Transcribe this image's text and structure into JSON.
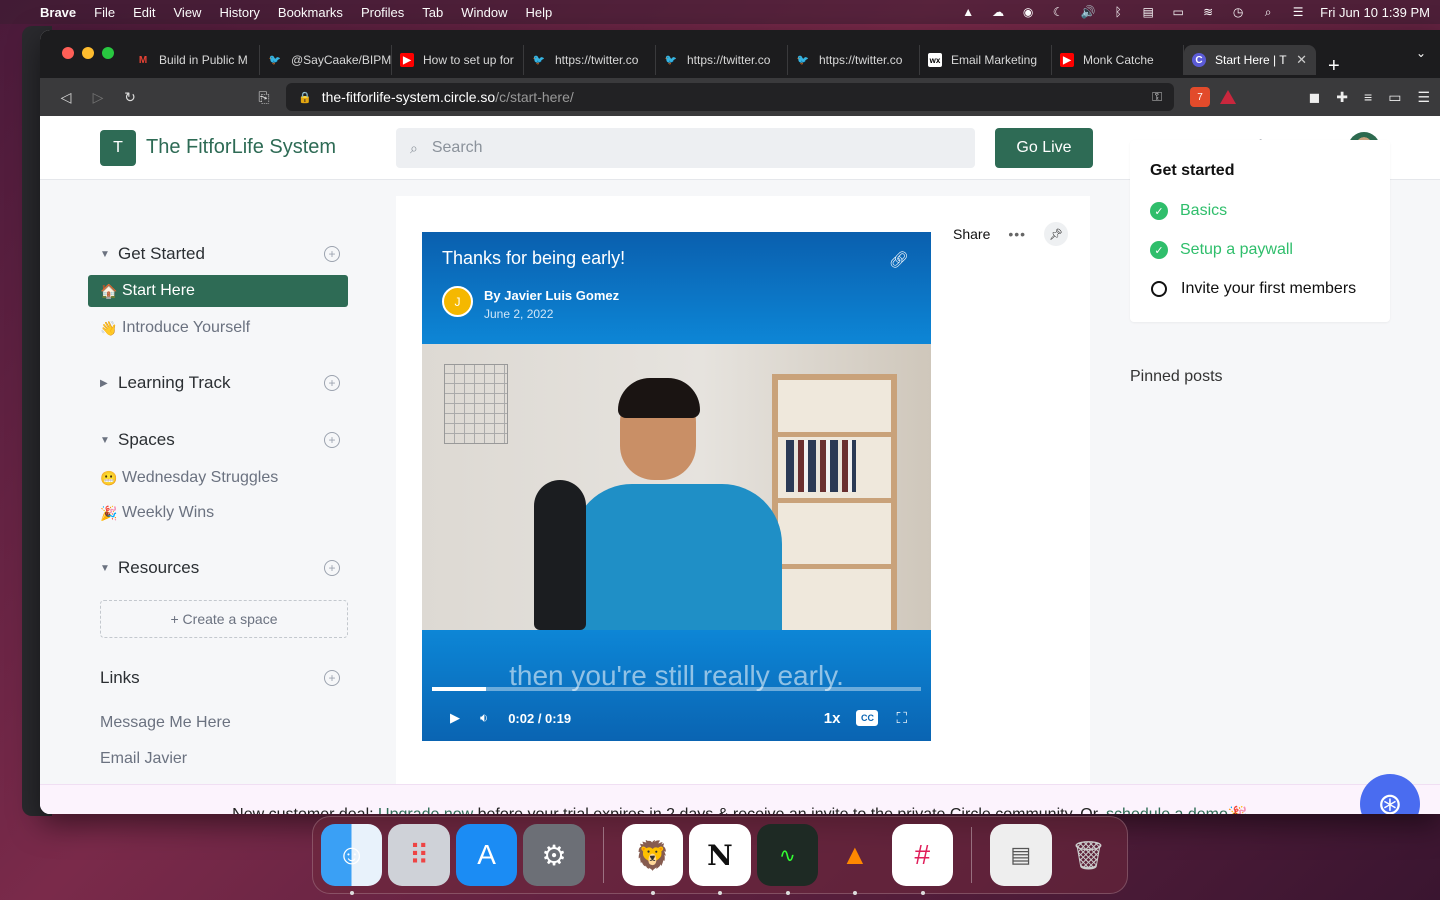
{
  "menubar": {
    "apple": "",
    "app": "Brave",
    "items": [
      "File",
      "Edit",
      "View",
      "History",
      "Bookmarks",
      "Profiles",
      "Tab",
      "Window",
      "Help"
    ],
    "datetime": "Fri Jun 10  1:39 PM"
  },
  "browser": {
    "tabs": [
      {
        "label": "Build in Public M",
        "favicon": "M",
        "color": "#ea4335"
      },
      {
        "label": "@SayCaake/BIPM",
        "favicon": "t",
        "color": "#1d9bf0"
      },
      {
        "label": "How to set up for",
        "favicon": "▶",
        "color": "#ff0000"
      },
      {
        "label": "https://twitter.co",
        "favicon": "t",
        "color": "#1d9bf0"
      },
      {
        "label": "https://twitter.co",
        "favicon": "t",
        "color": "#1d9bf0"
      },
      {
        "label": "https://twitter.co",
        "favicon": "t",
        "color": "#1d9bf0"
      },
      {
        "label": "Email Marketing",
        "favicon": "wx",
        "color": "#ffffff"
      },
      {
        "label": "Monk Catche",
        "favicon": "▶",
        "color": "#ff0000"
      },
      {
        "label": "Start Here | T",
        "favicon": "C",
        "color": "#5b5bd6"
      }
    ],
    "url_domain": "the-fitforlife-system.circle.so",
    "url_path": "/c/start-here/",
    "shield_count": "7"
  },
  "header": {
    "logo_letter": "T",
    "brand": "The FitforLife System",
    "search_placeholder": "Search",
    "go_live": "Go Live"
  },
  "sidebar": {
    "get_started": "Get Started",
    "start_here": "Start Here",
    "start_here_emoji": "🏠",
    "introduce": "Introduce Yourself",
    "introduce_emoji": "👋",
    "learning_track": "Learning Track",
    "spaces": "Spaces",
    "wednesday": "Wednesday Struggles",
    "wednesday_emoji": "😬",
    "weekly": "Weekly Wins",
    "weekly_emoji": "🎉",
    "resources": "Resources",
    "create_space": "+ Create a space",
    "links": "Links",
    "link1": "Message Me Here",
    "link2": "Email Javier"
  },
  "post": {
    "share": "Share",
    "dots": "•••",
    "video_title": "Thanks for being early!",
    "author_initial": "J",
    "author": "By Javier Luis Gomez",
    "date": "June 2, 2022",
    "caption": "then you're still really early.",
    "time": "0:02 / 0:19",
    "progress": 0.11,
    "speed": "1x",
    "cc": "CC"
  },
  "get_started_card": {
    "title": "Get started",
    "items": [
      {
        "label": "Basics",
        "done": true
      },
      {
        "label": "Setup a paywall",
        "done": true
      },
      {
        "label": "Invite your first members",
        "done": false
      }
    ]
  },
  "pinned": "Pinned posts",
  "banner": {
    "prefix": "New customer deal: ",
    "upgrade": "Upgrade now",
    "middle": " before your trial expires in 2 days & receive an invite to the private Circle community. Or, ",
    "demo": "schedule a demo",
    "emoji": " 🎉"
  },
  "dock": [
    "finder-icon",
    "launchpad-icon",
    "app-store-icon",
    "system-preferences-icon",
    "brave-icon",
    "notion-icon",
    "activity-monitor-icon",
    "vlc-icon",
    "slack-icon",
    "preview-icon",
    "trash-icon"
  ]
}
